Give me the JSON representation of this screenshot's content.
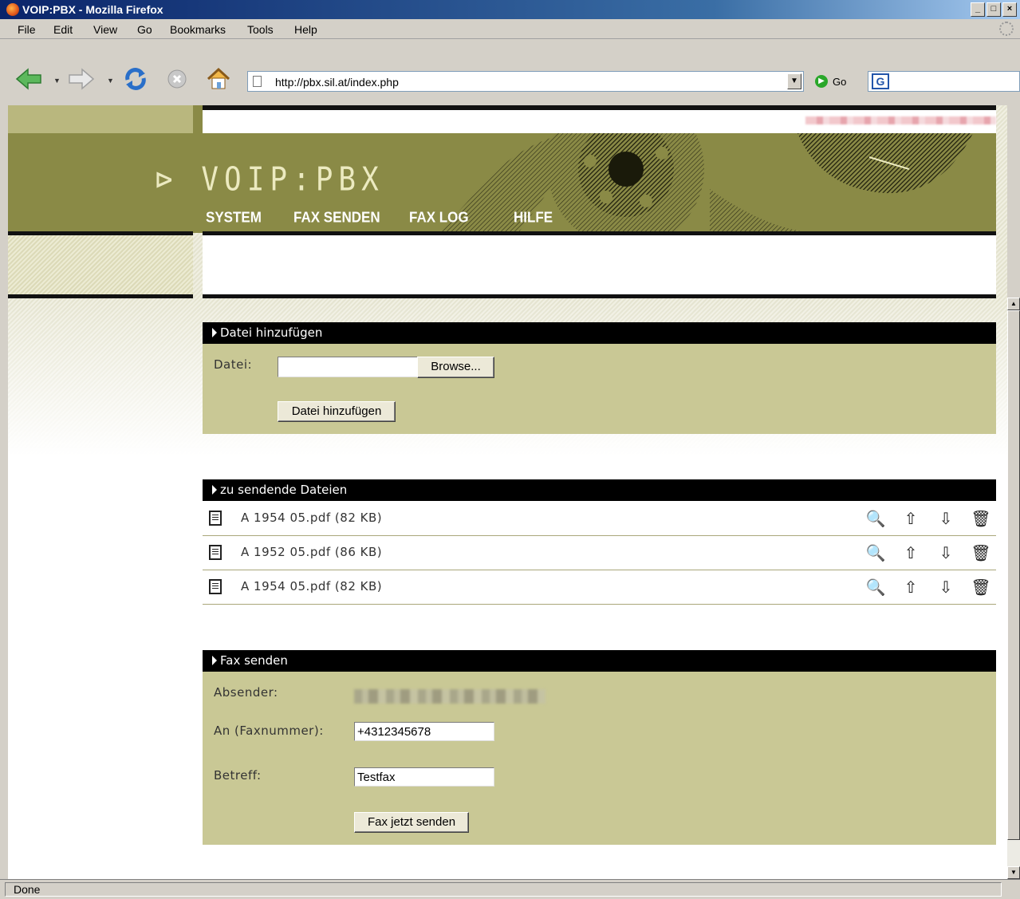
{
  "window": {
    "title": "VOIP:PBX - Mozilla Firefox",
    "min": "_",
    "max": "□",
    "close": "×"
  },
  "menu": [
    "File",
    "Edit",
    "View",
    "Go",
    "Bookmarks",
    "Tools",
    "Help"
  ],
  "toolbar": {
    "url": "http://pbx.sil.at/index.php",
    "go_label": "Go",
    "google_label": "G"
  },
  "site": {
    "logo": "VOIP:PBX",
    "logo_mark": "⊳",
    "nav": [
      "SYSTEM",
      "FAX SENDEN",
      "FAX LOG",
      "HILFE"
    ]
  },
  "add_file": {
    "heading": "Datei hinzufügen",
    "file_label": "Datei:",
    "file_value": "",
    "browse_label": "Browse...",
    "submit_label": "Datei hinzufügen"
  },
  "queue": {
    "heading": "zu sendende Dateien",
    "files": [
      {
        "name": "A 1954 05.pdf (82 KB)"
      },
      {
        "name": "A 1952 05.pdf (86 KB)"
      },
      {
        "name": "A 1954 05.pdf (82 KB)"
      }
    ],
    "actions": {
      "preview": "🔍",
      "up": "⇧",
      "down": "⇩",
      "delete": "🗑"
    }
  },
  "send": {
    "heading": "Fax senden",
    "sender_label": "Absender:",
    "to_label": "An (Faxnummer):",
    "to_value": "+4312345678",
    "subject_label": "Betreff:",
    "subject_value": "Testfax",
    "submit_label": "Fax jetzt senden"
  },
  "status": {
    "text": "Done"
  }
}
